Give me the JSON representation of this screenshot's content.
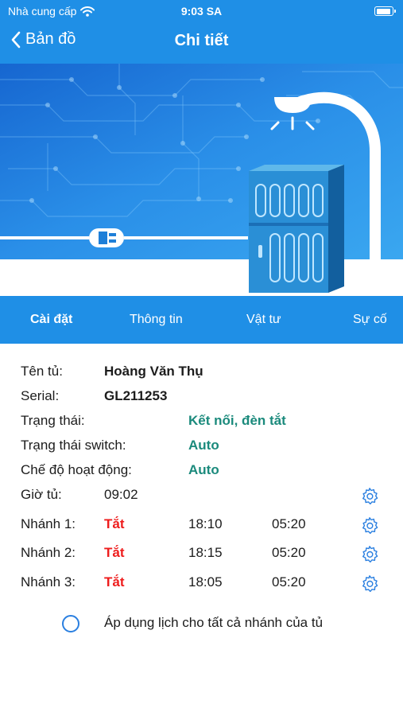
{
  "status_bar": {
    "carrier": "Nhà cung cấp",
    "time": "9:03 SA"
  },
  "nav": {
    "back_label": "Bản đồ",
    "title": "Chi tiết"
  },
  "tabs": [
    {
      "label": "Cài đặt",
      "active": true
    },
    {
      "label": "Thông tin",
      "active": false
    },
    {
      "label": "Vật tư",
      "active": false
    },
    {
      "label": "Sự cố",
      "active": false
    }
  ],
  "details": {
    "cabinet_name_label": "Tên tủ:",
    "cabinet_name": "Hoàng Văn Thụ",
    "serial_label": "Serial:",
    "serial": "GL211253",
    "status_label": "Trạng thái:",
    "status": "Kết nối, đèn tắt",
    "switch_status_label": "Trạng thái switch:",
    "switch_status": "Auto",
    "mode_label": "Chế độ hoạt động:",
    "mode": "Auto",
    "clock_label": "Giờ tủ:",
    "clock": "09:02"
  },
  "branches": [
    {
      "label": "Nhánh 1:",
      "state": "Tắt",
      "on_time": "18:10",
      "off_time": "05:20"
    },
    {
      "label": "Nhánh 2:",
      "state": "Tắt",
      "on_time": "18:15",
      "off_time": "05:20"
    },
    {
      "label": "Nhánh 3:",
      "state": "Tắt",
      "on_time": "18:05",
      "off_time": "05:20"
    }
  ],
  "apply_all_label": "Áp dụng lịch cho tất cả nhánh của tủ",
  "colors": {
    "primary": "#1f8fe6",
    "status_ok": "#1b8a7c",
    "off": "#ee1c1c",
    "icon": "#2a7fe0"
  },
  "icons": [
    "wifi-icon",
    "battery-icon",
    "back-chevron-icon",
    "gear-icon",
    "radio-button-icon"
  ]
}
